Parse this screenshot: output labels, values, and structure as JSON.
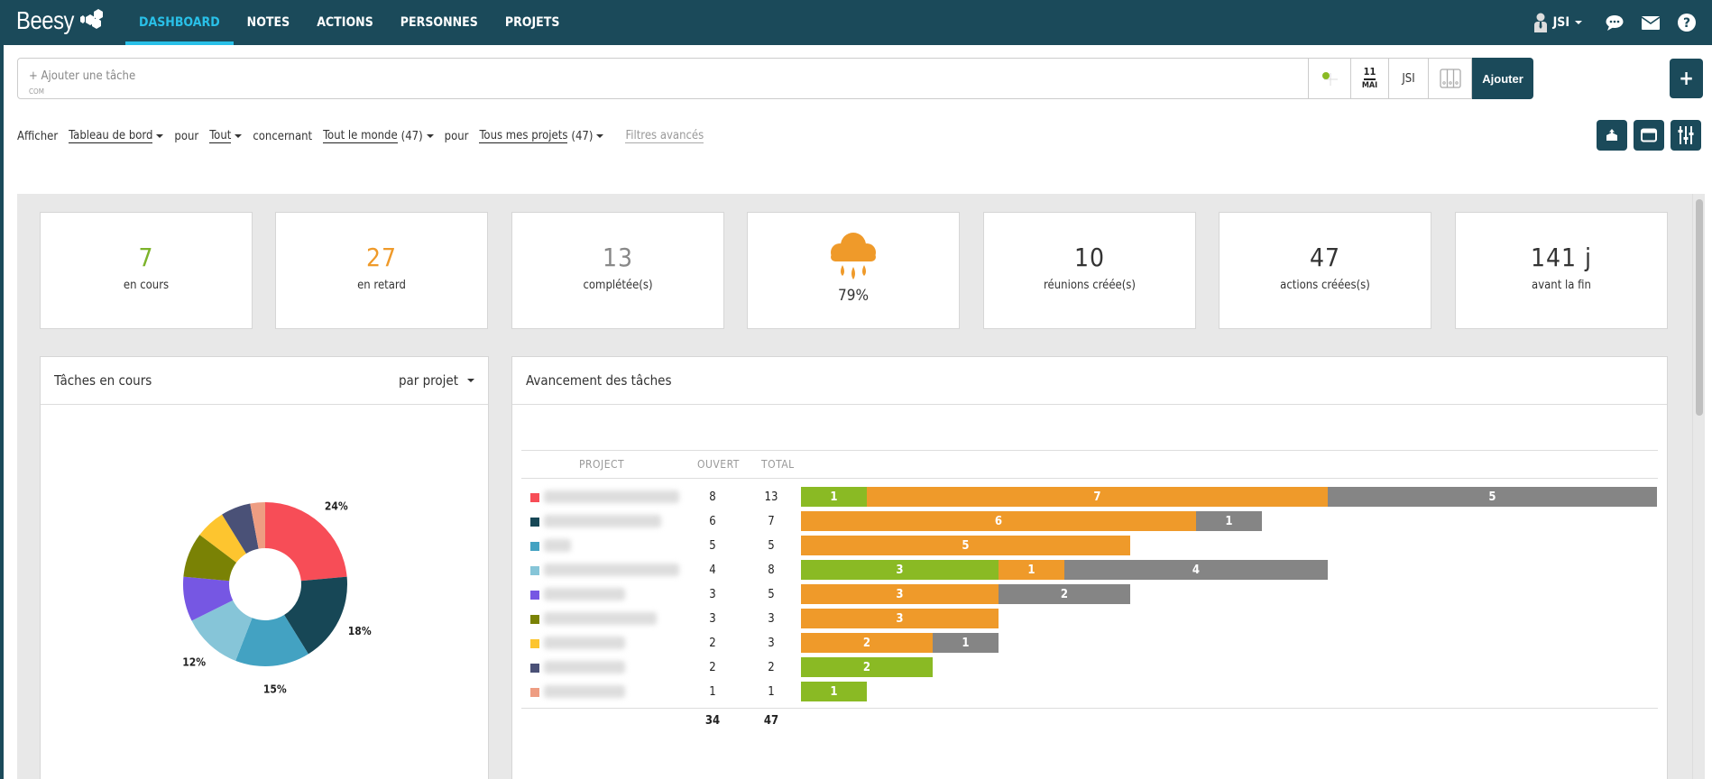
{
  "app": {
    "logo": "Beesy"
  },
  "nav": {
    "items": [
      {
        "label": "DASHBOARD",
        "active": true
      },
      {
        "label": "NOTES"
      },
      {
        "label": "ACTIONS"
      },
      {
        "label": "PERSONNES"
      },
      {
        "label": "PROJETS"
      }
    ],
    "user": "JSI",
    "icons": [
      "chat-icon",
      "mail-icon",
      "help-icon"
    ]
  },
  "task_bar": {
    "placeholder": "+ Ajouter une tâche",
    "sub_label": "COM",
    "date_day": "11",
    "date_month": "MAI",
    "assignee": "JSI",
    "add_label": "Ajouter",
    "plus_label": "+"
  },
  "filters": {
    "show_label": "Afficher",
    "view": "Tableau de bord",
    "for1_label": "pour",
    "scope": "Tout",
    "concerning_label": "concernant",
    "people": "Tout le monde",
    "people_count": "(47)",
    "for2_label": "pour",
    "projects": "Tous mes projets",
    "projects_count": "(47)",
    "advanced": "Filtres avancés"
  },
  "kpis": [
    {
      "value": "7",
      "label": "en cours",
      "color": "#7cb32a"
    },
    {
      "value": "27",
      "label": "en retard",
      "color": "#ef9a2a"
    },
    {
      "value": "13",
      "label": "complétée(s)",
      "color": "#888888"
    },
    {
      "value": "79%",
      "label": "",
      "icon": "rain-cloud-icon",
      "color": "#ef9a2a"
    },
    {
      "value": "10",
      "label": "réunions créée(s)",
      "color": "#333333"
    },
    {
      "value": "47",
      "label": "actions créées(s)",
      "color": "#333333"
    },
    {
      "value": "141 j",
      "label": "avant la fin",
      "color": "#333333"
    }
  ],
  "pie_panel": {
    "title": "Tâches en cours",
    "group_by": "par projet"
  },
  "progress_panel": {
    "title": "Avancement des tâches",
    "columns": [
      "PROJECT",
      "OUVERT",
      "TOTAL"
    ],
    "total_open": "34",
    "total_all": "47"
  },
  "colors": {
    "brand": "#1b4a5a",
    "accent": "#29c0e8",
    "done": "#8aba24",
    "late": "#ef9a2a",
    "completed": "#858585"
  },
  "chart_data": [
    {
      "type": "pie",
      "title": "Tâches en cours",
      "donut": true,
      "categories": [
        "Projet 1",
        "Projet 2",
        "Projet 3",
        "Projet 4",
        "Projet 5",
        "Projet 6",
        "Projet 7",
        "Projet 8",
        "Projet 9"
      ],
      "values": [
        8,
        6,
        5,
        4,
        3,
        3,
        2,
        2,
        1
      ],
      "colors": [
        "#f74d57",
        "#174756",
        "#43a2c2",
        "#86c5d8",
        "#7657e3",
        "#7a8205",
        "#fdc52f",
        "#4a5177",
        "#ee9d82"
      ],
      "labels": [
        "24%",
        "18%",
        "15%",
        "12%",
        "",
        "",
        "",
        "",
        ""
      ]
    },
    {
      "type": "bar",
      "orientation": "horizontal",
      "stacked": true,
      "title": "Avancement des tâches",
      "rows": [
        {
          "color": "#f74d57",
          "ouvert": 8,
          "total": 13,
          "segments": [
            1,
            7,
            5
          ]
        },
        {
          "color": "#174756",
          "ouvert": 6,
          "total": 7,
          "segments": [
            0,
            6,
            1
          ]
        },
        {
          "color": "#43a2c2",
          "ouvert": 5,
          "total": 5,
          "segments": [
            0,
            5,
            0
          ]
        },
        {
          "color": "#86c5d8",
          "ouvert": 4,
          "total": 8,
          "segments": [
            3,
            1,
            4
          ]
        },
        {
          "color": "#7657e3",
          "ouvert": 3,
          "total": 5,
          "segments": [
            0,
            3,
            2
          ]
        },
        {
          "color": "#7a8205",
          "ouvert": 3,
          "total": 3,
          "segments": [
            0,
            3,
            0
          ]
        },
        {
          "color": "#fdc52f",
          "ouvert": 2,
          "total": 3,
          "segments": [
            0,
            2,
            1
          ]
        },
        {
          "color": "#4a5177",
          "ouvert": 2,
          "total": 2,
          "segments": [
            2,
            0,
            0
          ]
        },
        {
          "color": "#ee9d82",
          "ouvert": 1,
          "total": 1,
          "segments": [
            1,
            0,
            0
          ]
        }
      ],
      "segment_series": [
        "en cours",
        "en retard",
        "complétée(s)"
      ],
      "segment_colors": [
        "#8aba24",
        "#ef9a2a",
        "#858585"
      ],
      "xlim": [
        0,
        13
      ]
    }
  ]
}
